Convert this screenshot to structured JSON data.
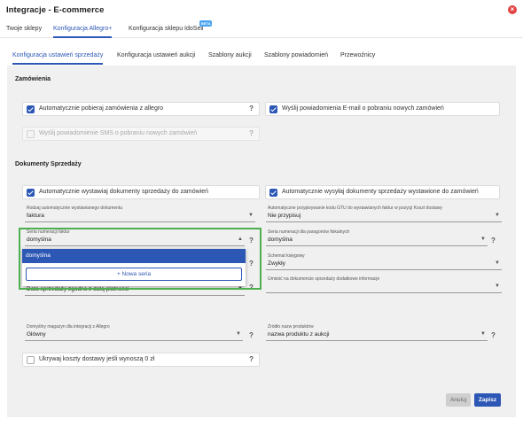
{
  "window": {
    "title": "Integracje - E-commerce"
  },
  "top_tabs": [
    {
      "label": "Twoje sklepy"
    },
    {
      "label": "Konfiguracja Allegro+"
    },
    {
      "label": "Konfiguracja sklepu IdoSell",
      "badge": "BETA"
    }
  ],
  "sub_tabs": [
    {
      "label": "Konfiguracja ustawień sprzedaży"
    },
    {
      "label": "Konfiguracja ustawień aukcji"
    },
    {
      "label": "Szablony aukcji"
    },
    {
      "label": "Szablony powiadomień"
    },
    {
      "label": "Przewoźnicy"
    }
  ],
  "orders": {
    "title": "Zamówienia",
    "auto_fetch": {
      "label": "Automatycznie pobieraj zamówienia z allegro",
      "checked": true
    },
    "email_notify": {
      "label": "Wyślij powiadomienia E-mail o pobraniu nowych zamówień",
      "checked": true
    },
    "sms_notify": {
      "label": "Wyślij powiadomienie SMS o pobraniu nowych zamówień",
      "checked": false,
      "disabled": true
    }
  },
  "sales_docs": {
    "title": "Dokumenty Sprzedaży",
    "auto_issue": {
      "label": "Automatycznie wystawiaj dokumenty sprzedaży do zamówień",
      "checked": true
    },
    "auto_send": {
      "label": "Automatycznie wysyłaj dokumenty sprzedaży wystawione do zamówień",
      "checked": true
    },
    "doc_type": {
      "label": "Rodzaj automatycznie wystawianego dokumentu",
      "value": "faktura"
    },
    "gtu": {
      "label": "Automatyczne przypisywanie kodu GTU do wystawianych faktur w pozycji Koszt dostawy",
      "value": "Nie przypisuj"
    },
    "invoice_series": {
      "label": "Seria numeracji faktur",
      "value": "domyślna"
    },
    "receipt_series": {
      "label": "Seria numeracji dla paragonów fiskalnych",
      "value": "domyślna"
    },
    "accounting_scheme": {
      "label": "Schemat księgowy",
      "value": "Zwykły"
    },
    "extra_info": {
      "label": "Umieść na dokumencie sprzedaży dodatkowe informacje",
      "value": ""
    },
    "sale_date": {
      "value": "Data sprzedaży zgodna z datą płatności"
    }
  },
  "dropdown": {
    "option": "domyślna",
    "new_series": "Nowa seria"
  },
  "misc": {
    "warehouse": {
      "label": "Domyślny magazyn dla integracji z Allegro",
      "value": "Główny"
    },
    "product_names": {
      "label": "Źródło nazw produktów",
      "value": "nazwa produktu z aukcji"
    },
    "hide_delivery": {
      "label": "Ukrywaj koszty dostawy jeśli wynoszą 0 zł",
      "checked": false
    }
  },
  "footer": {
    "cancel": "Anuluj",
    "save": "Zapisz"
  },
  "colors": {
    "accent": "#2d57b5",
    "highlight": "#4caf50",
    "close": "#e34242"
  }
}
